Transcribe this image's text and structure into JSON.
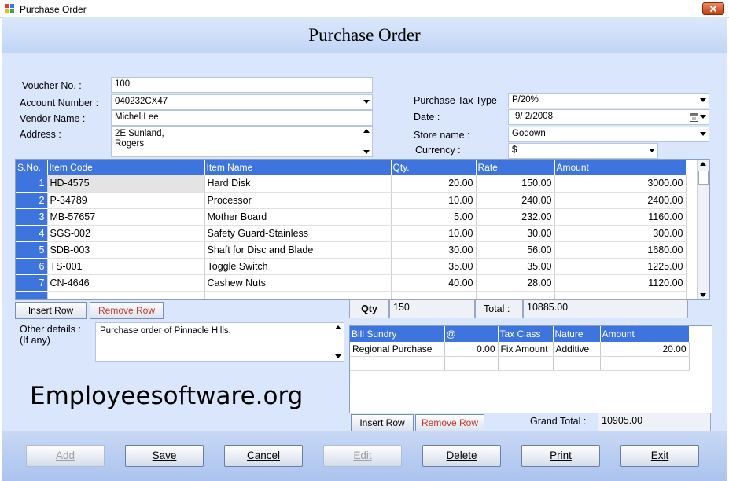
{
  "window": {
    "title": "Purchase Order",
    "close_label": "✕"
  },
  "page_title": "Purchase Order",
  "form": {
    "voucher_label": "Voucher No. :",
    "voucher_value": "100",
    "account_label": "Account Number :",
    "account_value": "040232CX47",
    "vendor_label": "Vendor Name :",
    "vendor_value": "Michel Lee",
    "address_label": "Address :",
    "address_line1": "2E Sunland,",
    "address_line2": "Rogers",
    "tax_label": "Purchase Tax Type",
    "tax_value": "P/20%",
    "date_label": "Date :",
    "date_value": "9/  2/2008",
    "store_label": "Store name :",
    "store_value": "Godown",
    "currency_label": "Currency :",
    "currency_value": "$"
  },
  "items_table": {
    "headers": [
      "S.No.",
      "Item Code",
      "Item Name",
      "Qty.",
      "Rate",
      "Amount"
    ],
    "rows": [
      [
        "1",
        "HD-4575",
        "Hard Disk",
        "20.00",
        "150.00",
        "3000.00"
      ],
      [
        "2",
        "P-34789",
        "Processor",
        "10.00",
        "240.00",
        "2400.00"
      ],
      [
        "3",
        "MB-57657",
        "Mother Board",
        "5.00",
        "232.00",
        "1160.00"
      ],
      [
        "4",
        "SGS-002",
        "Safety Guard-Stainless",
        "10.00",
        "30.00",
        "300.00"
      ],
      [
        "5",
        "SDB-003",
        "Shaft for Disc and Blade",
        "30.00",
        "56.00",
        "1680.00"
      ],
      [
        "6",
        "TS-001",
        "Toggle Switch",
        "35.00",
        "35.00",
        "1225.00"
      ],
      [
        "7",
        "CN-4646",
        "Cashew Nuts",
        "40.00",
        "28.00",
        "1120.00"
      ]
    ]
  },
  "item_buttons": {
    "insert": "Insert Row",
    "remove": "Remove Row"
  },
  "totals": {
    "qty_label": "Qty",
    "qty_value": "150",
    "total_label": "Total :",
    "total_value": "10885.00"
  },
  "other": {
    "label1": "Other details :",
    "label2": "(If any)",
    "value": "Purchase order of Pinnacle Hills."
  },
  "bill_table": {
    "headers": [
      "Bill Sundry",
      "@",
      "Tax Class",
      "Nature",
      "Amount"
    ],
    "rows": [
      [
        "Regional Purchase",
        "0.00",
        "Fix Amount",
        "Additive",
        "20.00"
      ]
    ]
  },
  "bill_buttons": {
    "insert": "Insert Row",
    "remove": "Remove Row"
  },
  "grand_total": {
    "label": "Grand Total :",
    "value": "10905.00"
  },
  "watermark": "Employeesoftware.org",
  "actions": {
    "add": "Add",
    "save": "Save",
    "cancel": "Cancel",
    "edit": "Edit",
    "delete": "Delete",
    "print": "Print",
    "exit": "Exit"
  }
}
